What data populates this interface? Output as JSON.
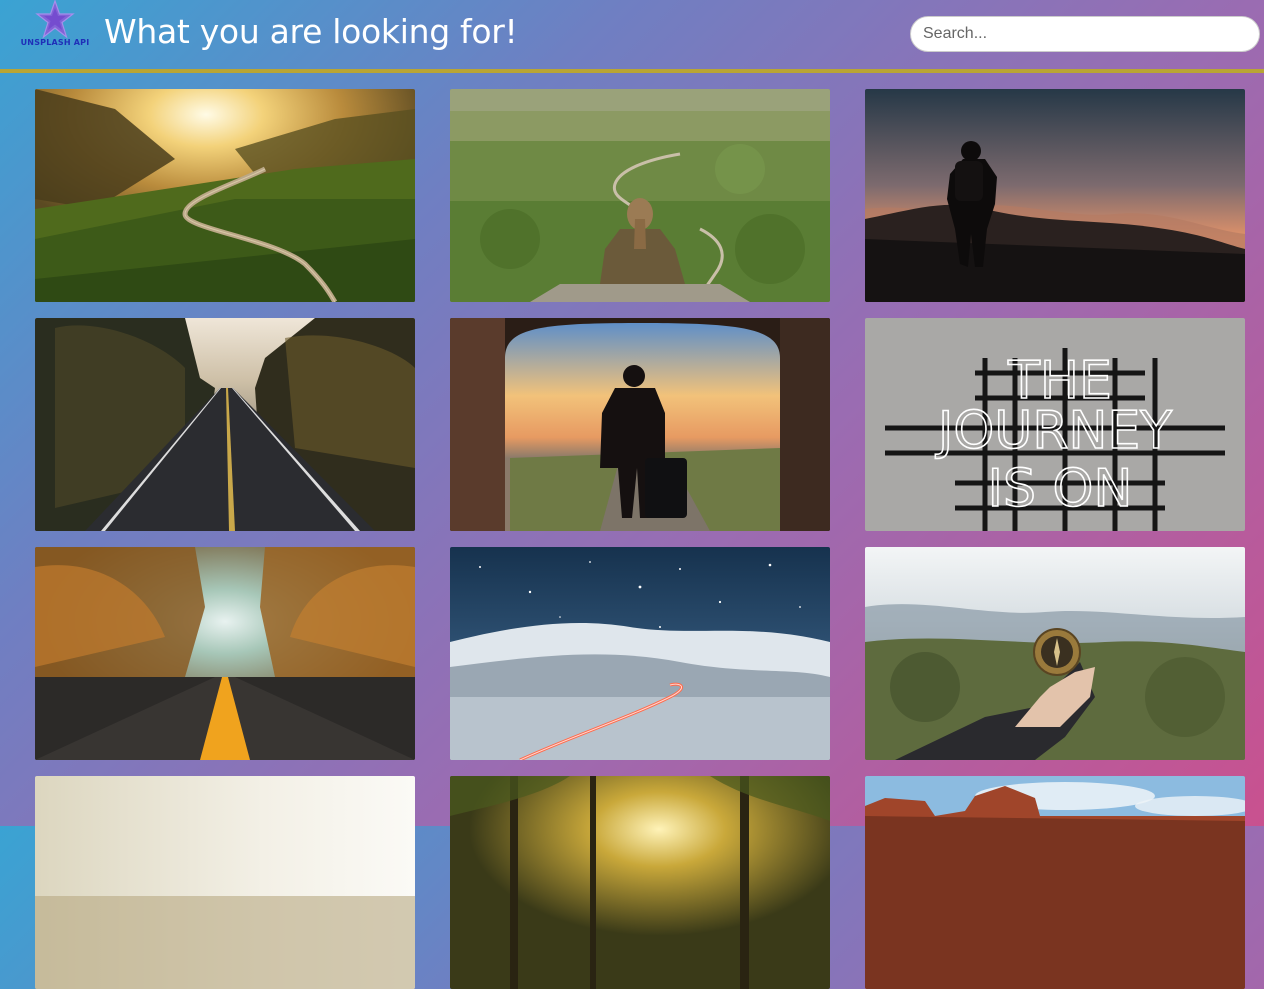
{
  "header": {
    "logo_text": "UNSPLASH API",
    "title": "What you are looking for!",
    "search_placeholder": "Search...",
    "divider_color": "#b9a534"
  },
  "photos": [
    {
      "subject": "sunlit mountain valley road"
    },
    {
      "subject": "woman sitting overlooking winding road"
    },
    {
      "subject": "hiker silhouette at sunset"
    },
    {
      "subject": "long straight road through forest"
    },
    {
      "subject": "traveler with suitcase in archway"
    },
    {
      "subject": "neon sign",
      "sign_text": [
        "THE",
        "JOURNEY",
        "IS ON"
      ]
    },
    {
      "subject": "autumn forest road"
    },
    {
      "subject": "starry night over snowy mountains"
    },
    {
      "subject": "hand holding compass"
    },
    {
      "subject": "bright hazy sky"
    },
    {
      "subject": "sunlit trees"
    },
    {
      "subject": "red rock formations"
    }
  ]
}
